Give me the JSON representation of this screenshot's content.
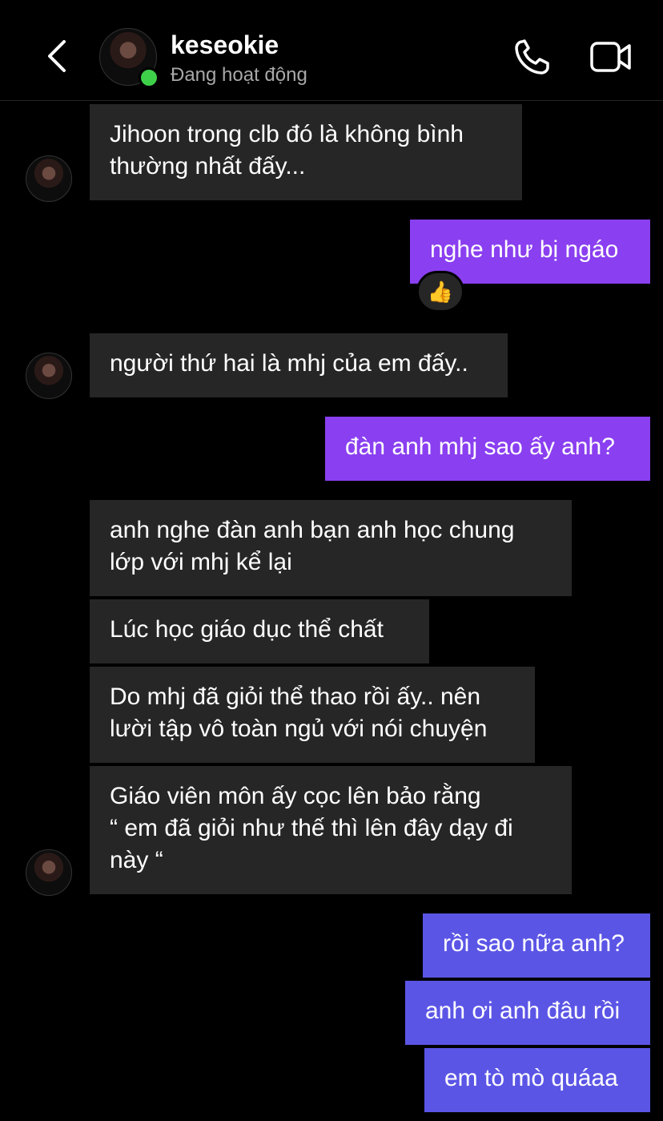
{
  "header": {
    "username": "keseokie",
    "status": "Đang hoạt động"
  },
  "messages": [
    {
      "text": "Jihoon trong clb đó là không bình\nthường nhất đấy..."
    },
    {
      "text": "nghe như bị ngáo",
      "reaction": "👍"
    },
    {
      "text": "người thứ hai là mhj của em đấy.."
    },
    {
      "text": "đàn anh mhj sao ấy anh?"
    },
    {
      "text": "anh nghe đàn anh bạn anh học chung\nlớp với mhj kể lại"
    },
    {
      "text": "Lúc học giáo dục thể chất"
    },
    {
      "text": "Do mhj đã giỏi thể thao rồi ấy.. nên\nlười tập vô toàn ngủ với nói chuyện"
    },
    {
      "text": "Giáo viên môn ấy cọc lên bảo rằng\n“ em đã giỏi như thế thì lên đây dạy đi\nnày “"
    },
    {
      "text": "rồi sao nữa anh?"
    },
    {
      "text": "anh ơi anh đâu rồi"
    },
    {
      "text": "em tò mò quáaa"
    }
  ],
  "icons": {
    "back": "chevron-left-icon",
    "call": "phone-icon",
    "video": "video-camera-icon"
  },
  "colors": {
    "incoming": "#262626",
    "outgoing_purple": "#8a3ff0",
    "outgoing_blue": "#5b55e6",
    "online": "#3fd04a"
  }
}
